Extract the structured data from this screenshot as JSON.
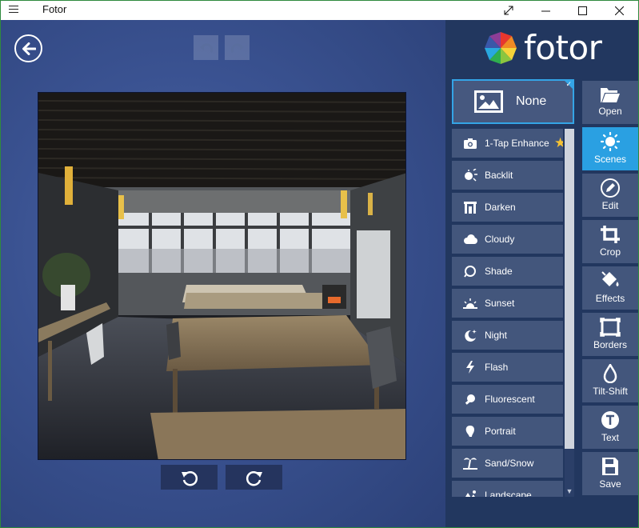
{
  "titlebar": {
    "title": "Fotor",
    "menu_icon": "hamburger-icon",
    "controls": [
      "fullscreen-icon",
      "minimize-icon",
      "maximize-icon",
      "close-icon"
    ]
  },
  "canvas": {
    "back_icon": "arrow-left-icon",
    "undo_icon": "undo-icon",
    "redo_icon": "redo-icon",
    "rotate_left_icon": "rotate-left-icon",
    "rotate_right_icon": "rotate-right-icon"
  },
  "brand": {
    "logo_text": "fotor"
  },
  "scenes": {
    "selected": {
      "label": "None",
      "icon": "image-icon"
    },
    "items": [
      {
        "label": "1-Tap Enhance",
        "icon": "camera-icon",
        "starred": true
      },
      {
        "label": "Backlit",
        "icon": "backlit-icon"
      },
      {
        "label": "Darken",
        "icon": "darken-icon"
      },
      {
        "label": "Cloudy",
        "icon": "cloud-icon"
      },
      {
        "label": "Shade",
        "icon": "shade-icon"
      },
      {
        "label": "Sunset",
        "icon": "sunset-icon"
      },
      {
        "label": "Night",
        "icon": "moon-icon"
      },
      {
        "label": "Flash",
        "icon": "flash-icon"
      },
      {
        "label": "Fluorescent",
        "icon": "bulb-icon"
      },
      {
        "label": "Portrait",
        "icon": "portrait-icon"
      },
      {
        "label": "Sand/Snow",
        "icon": "palm-tree-icon"
      },
      {
        "label": "Landscape",
        "icon": "landscape-icon"
      }
    ]
  },
  "tools": [
    {
      "label": "Open",
      "icon": "folder-icon",
      "active": false
    },
    {
      "label": "Scenes",
      "icon": "sun-icon",
      "active": true
    },
    {
      "label": "Edit",
      "icon": "pencil-icon",
      "active": false
    },
    {
      "label": "Crop",
      "icon": "crop-icon",
      "active": false
    },
    {
      "label": "Effects",
      "icon": "paint-bucket-icon",
      "active": false
    },
    {
      "label": "Borders",
      "icon": "border-frame-icon",
      "active": false
    },
    {
      "label": "Tilt-Shift",
      "icon": "droplet-icon",
      "active": false
    },
    {
      "label": "Text",
      "icon": "text-icon",
      "active": false
    },
    {
      "label": "Save",
      "icon": "save-icon",
      "active": false
    }
  ],
  "colors": {
    "accent": "#2aa0e2",
    "panel_bg": "#22375f",
    "tile_bg": "#43567c",
    "canvas_bg": "#3a5291",
    "window_border": "#2f8a3d"
  }
}
